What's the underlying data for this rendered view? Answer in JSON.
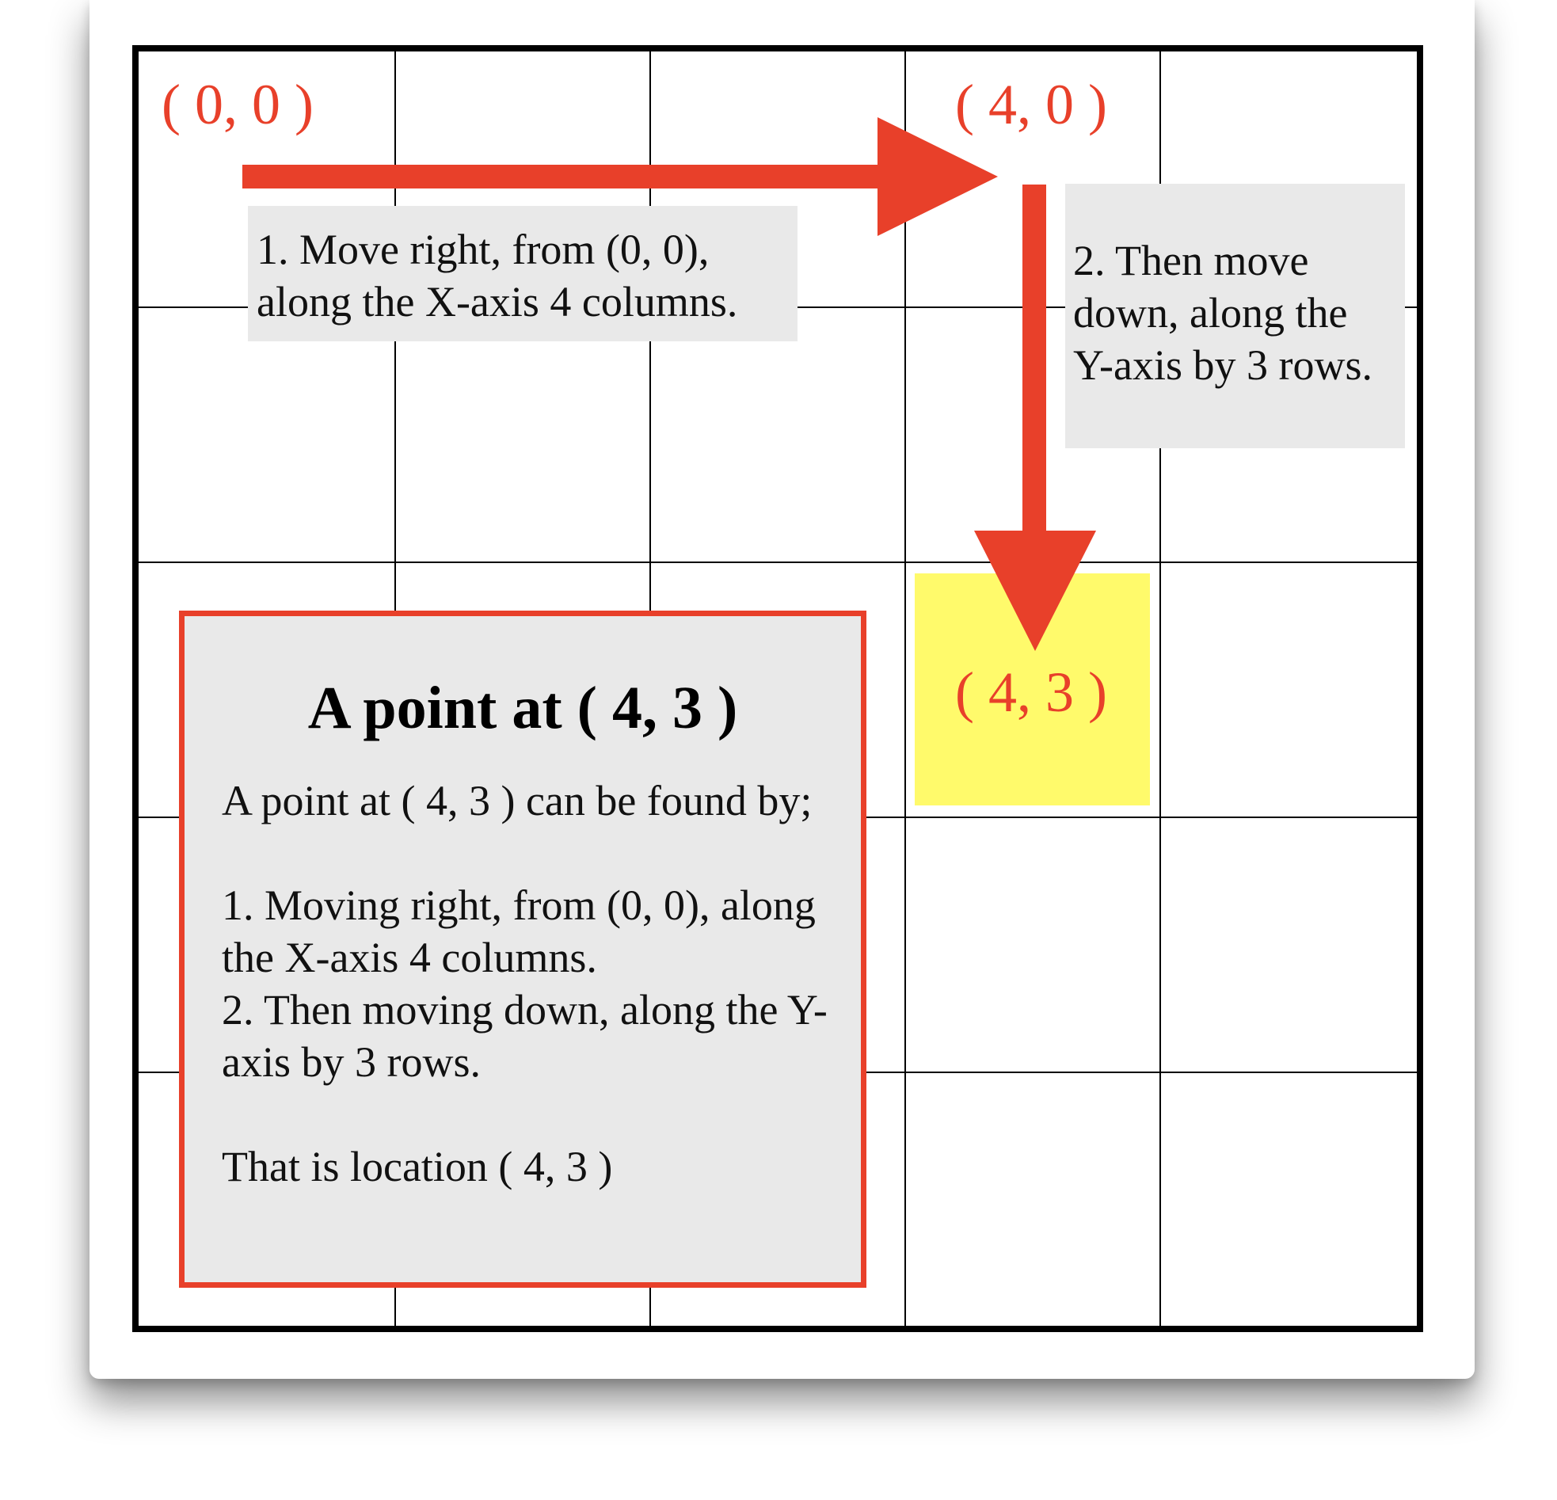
{
  "origin_label": "( 0, 0 )",
  "corner_label": "( 4, 0 )",
  "target_label": "( 4, 3 )",
  "step1_caption": "1. Move right, from (0, 0),\nalong the X-axis 4 columns.",
  "step2_caption": "2. Then move\ndown, along the\nY-axis by 3 rows.",
  "info": {
    "title": "A point at ( 4, 3 )",
    "intro": "A point at ( 4, 3 ) can be found by;",
    "step1": "1. Moving right, from (0, 0), along the X-axis 4 columns.",
    "step2": "2. Then moving down, along the Y-axis by 3 rows.",
    "conclusion": "That is location ( 4, 3 )"
  },
  "grid": {
    "columns": 5,
    "rows": 5
  },
  "point": {
    "x": 4,
    "y": 3
  },
  "colors": {
    "accent": "#e8402a",
    "highlight": "#fffa6b",
    "caption_background": "#e9e9e9",
    "grid_line": "#000000"
  }
}
